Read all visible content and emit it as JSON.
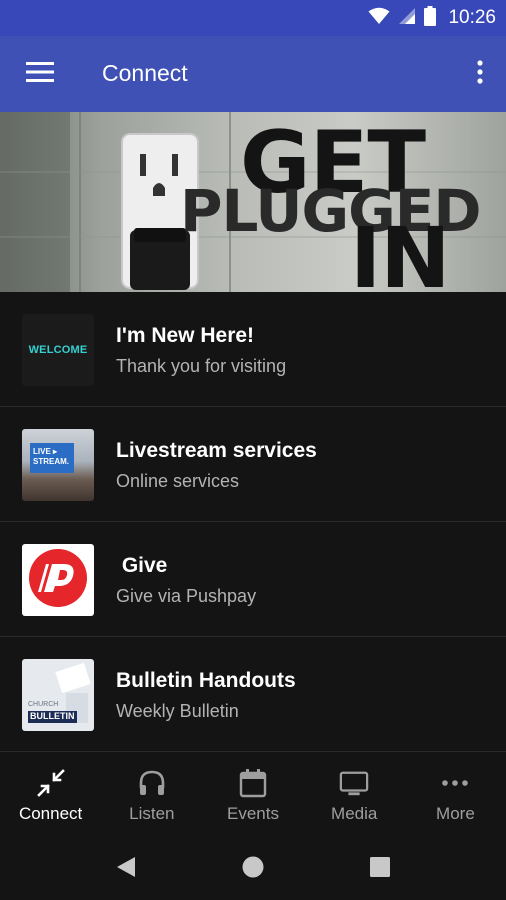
{
  "status_bar": {
    "time": "10:26"
  },
  "app_bar": {
    "title": "Connect"
  },
  "banner": {
    "line1": "GET",
    "line2": "PLUGGED",
    "line3": "IN"
  },
  "items": [
    {
      "title": "I'm New Here!",
      "subtitle": "Thank you for visiting",
      "thumb_text": "WELCOME"
    },
    {
      "title": "Livestream services",
      "subtitle": "Online services",
      "thumb_text_1": "LIVE ▸",
      "thumb_text_2": "STREAM."
    },
    {
      "title": " Give",
      "subtitle": "Give via Pushpay"
    },
    {
      "title": "Bulletin Handouts",
      "subtitle": "Weekly Bulletin",
      "thumb_text_1": "CHURCH",
      "thumb_text_2": "BULLETIN"
    }
  ],
  "bottom_nav": [
    {
      "label": "Connect",
      "icon": "collapse-arrows-icon",
      "active": true
    },
    {
      "label": "Listen",
      "icon": "headphones-icon"
    },
    {
      "label": "Events",
      "icon": "calendar-icon"
    },
    {
      "label": "Media",
      "icon": "tv-icon"
    },
    {
      "label": "More",
      "icon": "more-horizontal-icon"
    }
  ],
  "colors": {
    "primary": "#3f51b5",
    "status": "#3948b8",
    "background": "#141414",
    "welcome_accent": "#33d1d1",
    "pushpay_red": "#e5262b"
  }
}
